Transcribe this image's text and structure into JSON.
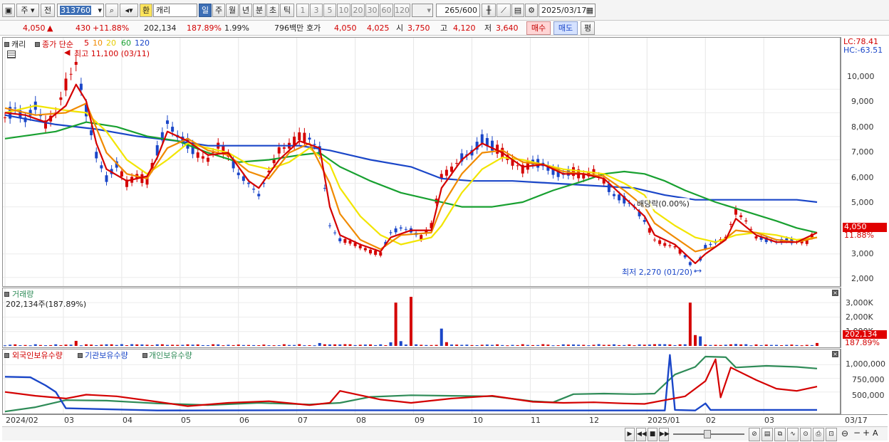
{
  "toolbar": {
    "period_type": "주",
    "market_type": "전",
    "stock_code": "313760",
    "exchange_badge": "환",
    "stock_name": "캐리",
    "periods": [
      "일",
      "주",
      "월",
      "년",
      "분",
      "초",
      "틱"
    ],
    "active_period": "일",
    "intervals": [
      "1",
      "3",
      "5",
      "10",
      "20",
      "30",
      "60",
      "120"
    ],
    "count_current": "265",
    "count_total": "/600",
    "date": "2025/03/17"
  },
  "quote": {
    "price": "4,050",
    "change_arrow": "▲",
    "change": "430",
    "change_pct": "+11.88%",
    "volume": "202,134",
    "volume_ratio": "187.89%",
    "turnover": "1.99%",
    "amount": "796백만",
    "bid_label": "호가",
    "ask_price": "4,050",
    "bid_price": "4,025",
    "open_label": "시",
    "open": "3,750",
    "high_label": "고",
    "high": "4,120",
    "low_label": "저",
    "low": "3,640",
    "buy_label": "매수",
    "sell_label": "매도",
    "eval_label": "평"
  },
  "price_panel": {
    "stock_label": "캐리",
    "ma_label": "종가 단순",
    "ma_periods": [
      "5",
      "10",
      "20",
      "60",
      "120"
    ],
    "ma_colors": [
      "#d40000",
      "#f08a00",
      "#f2e500",
      "#18a030",
      "#1a46c8"
    ],
    "high_note": "최고 11,100 (03/11)",
    "low_note": "최저 2,270 (01/20)",
    "dividend_note": "배당락(0.00%)",
    "lc": "LC:78.41",
    "hc": "HC:-63.51",
    "last_price": "4,050",
    "last_pct": "11.88%",
    "y_ticks": [
      "10,000",
      "9,000",
      "8,000",
      "7,000",
      "6,000",
      "5,000",
      "3,000",
      "2,000"
    ]
  },
  "volume_panel": {
    "title": "거래량",
    "value_label": "202,134주(187.89%)",
    "last_value": "202,134",
    "last_pct": "187.89%",
    "y_ticks": [
      "3,000K",
      "2,000K",
      "1,000K"
    ]
  },
  "holding_panel": {
    "series": [
      "외국인보유수량",
      "기관보유수량",
      "개인보유수량"
    ],
    "series_colors": [
      "#d40000",
      "#1a46c8",
      "#2e8b57"
    ],
    "y_ticks": [
      "1,000,000",
      "750,000",
      "500,000"
    ]
  },
  "x_axis": {
    "labels": [
      "2024/02",
      "03",
      "04",
      "05",
      "06",
      "07",
      "08",
      "09",
      "10",
      "11",
      "12",
      "2025/01",
      "02",
      "03"
    ],
    "last_label": "03/17"
  },
  "chart_data": {
    "type": "line",
    "price_ticks": [
      10000,
      9000,
      8000,
      7000,
      6000,
      5000,
      3000,
      2000
    ],
    "price_range": [
      1750,
      11100
    ],
    "price_path": [
      [
        0,
        8800
      ],
      [
        2,
        9200
      ],
      [
        4,
        8700
      ],
      [
        6,
        9300
      ],
      [
        8,
        8500
      ],
      [
        10,
        9000
      ],
      [
        12,
        10200
      ],
      [
        14,
        11100
      ],
      [
        16,
        9100
      ],
      [
        18,
        7200
      ],
      [
        20,
        6200
      ],
      [
        22,
        6800
      ],
      [
        24,
        6000
      ],
      [
        26,
        6300
      ],
      [
        28,
        6100
      ],
      [
        30,
        7400
      ],
      [
        32,
        8600
      ],
      [
        34,
        8000
      ],
      [
        36,
        7700
      ],
      [
        38,
        7200
      ],
      [
        40,
        7000
      ],
      [
        42,
        7600
      ],
      [
        44,
        7200
      ],
      [
        46,
        6400
      ],
      [
        48,
        6000
      ],
      [
        50,
        5500
      ],
      [
        52,
        6500
      ],
      [
        54,
        7400
      ],
      [
        56,
        7600
      ],
      [
        58,
        8000
      ],
      [
        60,
        7900
      ],
      [
        62,
        7400
      ],
      [
        64,
        4200
      ],
      [
        66,
        3600
      ],
      [
        68,
        3500
      ],
      [
        70,
        3300
      ],
      [
        72,
        3100
      ],
      [
        74,
        3000
      ],
      [
        76,
        3900
      ],
      [
        78,
        4100
      ],
      [
        80,
        4000
      ],
      [
        82,
        3700
      ],
      [
        84,
        4200
      ],
      [
        86,
        6300
      ],
      [
        88,
        6600
      ],
      [
        90,
        7100
      ],
      [
        92,
        7300
      ],
      [
        94,
        7900
      ],
      [
        96,
        7600
      ],
      [
        98,
        7300
      ],
      [
        100,
        6900
      ],
      [
        102,
        6600
      ],
      [
        104,
        6900
      ],
      [
        106,
        6800
      ],
      [
        108,
        6500
      ],
      [
        110,
        6400
      ],
      [
        112,
        6500
      ],
      [
        114,
        6300
      ],
      [
        116,
        6500
      ],
      [
        118,
        6100
      ],
      [
        120,
        5500
      ],
      [
        122,
        5300
      ],
      [
        124,
        5000
      ],
      [
        126,
        4400
      ],
      [
        128,
        3600
      ],
      [
        130,
        3400
      ],
      [
        132,
        3300
      ],
      [
        134,
        2900
      ],
      [
        136,
        2270
      ],
      [
        138,
        3300
      ],
      [
        140,
        3500
      ],
      [
        142,
        3700
      ],
      [
        144,
        4800
      ],
      [
        146,
        4400
      ],
      [
        148,
        3700
      ],
      [
        150,
        3600
      ],
      [
        152,
        3500
      ],
      [
        154,
        3600
      ],
      [
        156,
        3500
      ],
      [
        158,
        3500
      ],
      [
        160,
        4050
      ]
    ],
    "ma5_path": [
      [
        0,
        9000
      ],
      [
        4,
        8900
      ],
      [
        8,
        8600
      ],
      [
        12,
        9300
      ],
      [
        14,
        10200
      ],
      [
        16,
        9500
      ],
      [
        18,
        7700
      ],
      [
        20,
        6600
      ],
      [
        24,
        6100
      ],
      [
        28,
        6300
      ],
      [
        30,
        7100
      ],
      [
        32,
        8200
      ],
      [
        36,
        7800
      ],
      [
        40,
        7200
      ],
      [
        44,
        7300
      ],
      [
        48,
        6100
      ],
      [
        50,
        5800
      ],
      [
        54,
        7000
      ],
      [
        58,
        7800
      ],
      [
        62,
        7500
      ],
      [
        64,
        5000
      ],
      [
        66,
        3800
      ],
      [
        70,
        3400
      ],
      [
        74,
        3100
      ],
      [
        76,
        3700
      ],
      [
        80,
        4000
      ],
      [
        84,
        4000
      ],
      [
        86,
        5800
      ],
      [
        90,
        7000
      ],
      [
        94,
        7700
      ],
      [
        98,
        7300
      ],
      [
        102,
        6700
      ],
      [
        106,
        6800
      ],
      [
        110,
        6400
      ],
      [
        114,
        6400
      ],
      [
        118,
        6200
      ],
      [
        122,
        5400
      ],
      [
        126,
        4600
      ],
      [
        128,
        3800
      ],
      [
        132,
        3400
      ],
      [
        136,
        2600
      ],
      [
        138,
        3000
      ],
      [
        142,
        3600
      ],
      [
        144,
        4500
      ],
      [
        148,
        3800
      ],
      [
        152,
        3500
      ],
      [
        156,
        3500
      ],
      [
        160,
        3900
      ]
    ],
    "ma10_path": [
      [
        0,
        9200
      ],
      [
        6,
        8900
      ],
      [
        12,
        9000
      ],
      [
        16,
        9400
      ],
      [
        20,
        7300
      ],
      [
        24,
        6400
      ],
      [
        28,
        6200
      ],
      [
        32,
        7500
      ],
      [
        36,
        7900
      ],
      [
        40,
        7400
      ],
      [
        44,
        7200
      ],
      [
        48,
        6500
      ],
      [
        52,
        6200
      ],
      [
        56,
        7300
      ],
      [
        60,
        7700
      ],
      [
        64,
        6000
      ],
      [
        66,
        4700
      ],
      [
        70,
        3600
      ],
      [
        74,
        3200
      ],
      [
        78,
        3800
      ],
      [
        84,
        3900
      ],
      [
        86,
        5000
      ],
      [
        90,
        6400
      ],
      [
        94,
        7300
      ],
      [
        98,
        7400
      ],
      [
        102,
        6900
      ],
      [
        106,
        6800
      ],
      [
        110,
        6500
      ],
      [
        114,
        6400
      ],
      [
        118,
        6300
      ],
      [
        122,
        5700
      ],
      [
        126,
        5000
      ],
      [
        128,
        4300
      ],
      [
        132,
        3700
      ],
      [
        136,
        3100
      ],
      [
        140,
        3300
      ],
      [
        144,
        4000
      ],
      [
        148,
        3900
      ],
      [
        152,
        3600
      ],
      [
        156,
        3500
      ],
      [
        160,
        3700
      ]
    ],
    "ma20_path": [
      [
        0,
        9000
      ],
      [
        6,
        9300
      ],
      [
        12,
        9100
      ],
      [
        16,
        9000
      ],
      [
        20,
        8200
      ],
      [
        24,
        7000
      ],
      [
        28,
        6400
      ],
      [
        32,
        7000
      ],
      [
        36,
        7700
      ],
      [
        40,
        7500
      ],
      [
        44,
        7300
      ],
      [
        48,
        6800
      ],
      [
        52,
        6600
      ],
      [
        56,
        6900
      ],
      [
        60,
        7500
      ],
      [
        64,
        6800
      ],
      [
        66,
        5800
      ],
      [
        70,
        4600
      ],
      [
        74,
        3800
      ],
      [
        78,
        3400
      ],
      [
        84,
        3700
      ],
      [
        86,
        4200
      ],
      [
        90,
        5600
      ],
      [
        94,
        6600
      ],
      [
        98,
        7100
      ],
      [
        102,
        7000
      ],
      [
        106,
        6800
      ],
      [
        110,
        6600
      ],
      [
        114,
        6500
      ],
      [
        118,
        6400
      ],
      [
        122,
        6000
      ],
      [
        126,
        5500
      ],
      [
        128,
        4800
      ],
      [
        132,
        4200
      ],
      [
        136,
        3700
      ],
      [
        140,
        3500
      ],
      [
        144,
        3800
      ],
      [
        148,
        3900
      ],
      [
        152,
        3800
      ],
      [
        156,
        3600
      ],
      [
        160,
        3700
      ]
    ],
    "ma60_path": [
      [
        0,
        7900
      ],
      [
        10,
        8200
      ],
      [
        16,
        8600
      ],
      [
        22,
        8400
      ],
      [
        28,
        8000
      ],
      [
        34,
        7800
      ],
      [
        40,
        7300
      ],
      [
        46,
        6900
      ],
      [
        52,
        7000
      ],
      [
        58,
        7200
      ],
      [
        62,
        7300
      ],
      [
        66,
        6700
      ],
      [
        72,
        6100
      ],
      [
        78,
        5600
      ],
      [
        84,
        5300
      ],
      [
        90,
        5000
      ],
      [
        96,
        5000
      ],
      [
        102,
        5200
      ],
      [
        108,
        5700
      ],
      [
        114,
        6100
      ],
      [
        118,
        6400
      ],
      [
        122,
        6500
      ],
      [
        126,
        6400
      ],
      [
        130,
        6100
      ],
      [
        134,
        5700
      ],
      [
        140,
        5200
      ],
      [
        146,
        4800
      ],
      [
        152,
        4400
      ],
      [
        156,
        4100
      ],
      [
        160,
        3900
      ]
    ],
    "ma120_path": [
      [
        0,
        8900
      ],
      [
        10,
        8500
      ],
      [
        18,
        8300
      ],
      [
        26,
        8000
      ],
      [
        34,
        7800
      ],
      [
        40,
        7600
      ],
      [
        50,
        7600
      ],
      [
        58,
        7600
      ],
      [
        64,
        7400
      ],
      [
        72,
        7000
      ],
      [
        80,
        6700
      ],
      [
        86,
        6200
      ],
      [
        92,
        6100
      ],
      [
        100,
        6100
      ],
      [
        108,
        6000
      ],
      [
        116,
        5900
      ],
      [
        124,
        5800
      ],
      [
        130,
        5500
      ],
      [
        136,
        5300
      ],
      [
        144,
        5300
      ],
      [
        150,
        5300
      ],
      [
        156,
        5300
      ],
      [
        160,
        5200
      ]
    ],
    "volume_ticks_k": [
      3000,
      2000,
      1000
    ],
    "volume_range_k": [
      0,
      3600
    ],
    "volume_k": [
      [
        12,
        90
      ],
      [
        14,
        350
      ],
      [
        20,
        110
      ],
      [
        34,
        70
      ],
      [
        48,
        65
      ],
      [
        62,
        200
      ],
      [
        76,
        250
      ],
      [
        77,
        3000
      ],
      [
        78,
        330
      ],
      [
        80,
        3400
      ],
      [
        86,
        1200
      ],
      [
        87,
        260
      ],
      [
        100,
        70
      ],
      [
        122,
        60
      ],
      [
        134,
        110
      ],
      [
        135,
        3000
      ],
      [
        136,
        750
      ],
      [
        137,
        660
      ],
      [
        144,
        130
      ],
      [
        152,
        70
      ],
      [
        160,
        202
      ]
    ],
    "holding_ticks": [
      1000000,
      750000,
      500000
    ],
    "holding_range": [
      130000,
      1150000
    ],
    "foreign_path": [
      [
        0,
        500000
      ],
      [
        6,
        430000
      ],
      [
        12,
        380000
      ],
      [
        16,
        450000
      ],
      [
        22,
        420000
      ],
      [
        30,
        320000
      ],
      [
        36,
        240000
      ],
      [
        44,
        300000
      ],
      [
        52,
        330000
      ],
      [
        60,
        260000
      ],
      [
        64,
        300000
      ],
      [
        66,
        520000
      ],
      [
        70,
        440000
      ],
      [
        74,
        360000
      ],
      [
        80,
        300000
      ],
      [
        88,
        380000
      ],
      [
        96,
        430000
      ],
      [
        104,
        320000
      ],
      [
        110,
        300000
      ],
      [
        116,
        310000
      ],
      [
        122,
        290000
      ],
      [
        126,
        280000
      ],
      [
        130,
        350000
      ],
      [
        134,
        420000
      ],
      [
        136,
        560000
      ],
      [
        138,
        700000
      ],
      [
        140,
        1100000
      ],
      [
        141,
        400000
      ],
      [
        143,
        950000
      ],
      [
        148,
        720000
      ],
      [
        152,
        560000
      ],
      [
        156,
        520000
      ],
      [
        160,
        600000
      ]
    ],
    "institution_path": [
      [
        0,
        780000
      ],
      [
        5,
        770000
      ],
      [
        8,
        620000
      ],
      [
        10,
        500000
      ],
      [
        12,
        200000
      ],
      [
        30,
        160000
      ],
      [
        60,
        165000
      ],
      [
        100,
        160000
      ],
      [
        125,
        160000
      ],
      [
        130,
        160000
      ],
      [
        131,
        1180000
      ],
      [
        132,
        170000
      ],
      [
        136,
        160000
      ],
      [
        138,
        290000
      ],
      [
        139,
        170000
      ],
      [
        160,
        170000
      ]
    ],
    "individual_path": [
      [
        0,
        140000
      ],
      [
        6,
        220000
      ],
      [
        12,
        350000
      ],
      [
        20,
        340000
      ],
      [
        30,
        290000
      ],
      [
        40,
        260000
      ],
      [
        50,
        300000
      ],
      [
        60,
        270000
      ],
      [
        66,
        300000
      ],
      [
        72,
        410000
      ],
      [
        80,
        440000
      ],
      [
        88,
        430000
      ],
      [
        96,
        420000
      ],
      [
        104,
        330000
      ],
      [
        108,
        310000
      ],
      [
        112,
        460000
      ],
      [
        118,
        470000
      ],
      [
        124,
        460000
      ],
      [
        128,
        470000
      ],
      [
        132,
        820000
      ],
      [
        136,
        960000
      ],
      [
        138,
        1150000
      ],
      [
        142,
        1140000
      ],
      [
        144,
        950000
      ],
      [
        150,
        980000
      ],
      [
        156,
        960000
      ],
      [
        160,
        930000
      ]
    ]
  }
}
